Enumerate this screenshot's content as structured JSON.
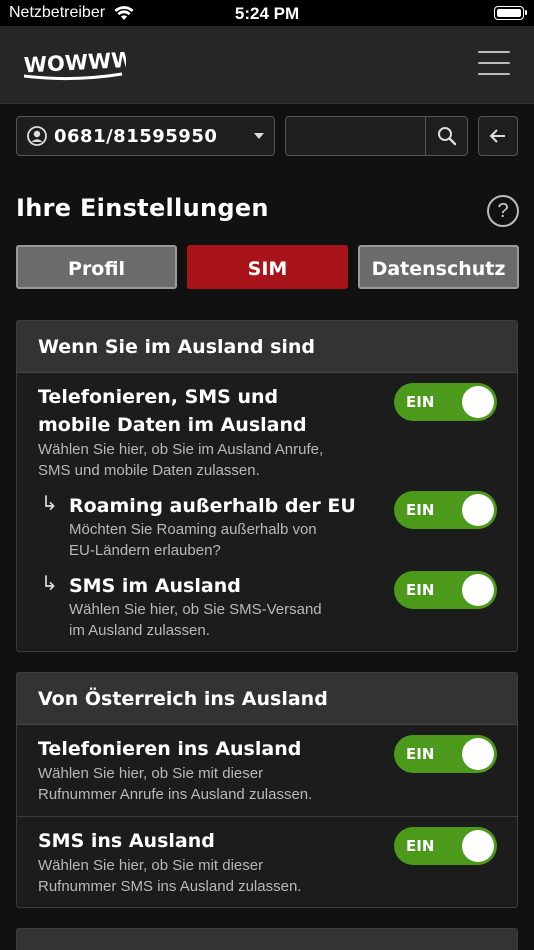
{
  "statusbar": {
    "carrier": "Netzbetreiber",
    "time": "5:24 PM"
  },
  "header": {
    "logo_text": "WOWWW!"
  },
  "number_select": {
    "value": "0681/81595950"
  },
  "search": {
    "placeholder": ""
  },
  "page": {
    "title": "Ihre Einstellungen",
    "help_label": "?"
  },
  "tabs": [
    {
      "label": "Profil",
      "active": false
    },
    {
      "label": "SIM",
      "active": true
    },
    {
      "label": "Datenschutz",
      "active": false
    }
  ],
  "colors": {
    "accent": "#a81419",
    "toggle_on": "#4c9a1c",
    "background": "#111111",
    "card_header": "#333333"
  },
  "sections": [
    {
      "title": "Wenn Sie im Ausland sind",
      "rows": [
        {
          "title_line1": "Telefonieren, SMS und",
          "title_line2": "mobile Daten im Ausland",
          "desc_line1": "Wählen Sie hier, ob Sie im Ausland Anrufe,",
          "desc_line2": "SMS und mobile Daten zulassen.",
          "toggle": "EIN"
        },
        {
          "arrow": "↳",
          "title": "Roaming außerhalb der EU",
          "desc_line1": "Möchten Sie Roaming außerhalb von",
          "desc_line2": "EU-Ländern erlauben?",
          "toggle": "EIN"
        },
        {
          "arrow": "↳",
          "title": "SMS im Ausland",
          "desc_line1": "Wählen Sie hier, ob Sie SMS-Versand",
          "desc_line2": "im Ausland zulassen.",
          "toggle": "EIN"
        }
      ]
    },
    {
      "title": "Von Österreich ins Ausland",
      "rows": [
        {
          "title": "Telefonieren ins Ausland",
          "desc_line1": "Wählen Sie hier, ob Sie mit dieser",
          "desc_line2": "Rufnummer Anrufe ins Ausland zulassen.",
          "toggle": "EIN"
        },
        {
          "title": "SMS ins Ausland",
          "desc_line1": "Wählen Sie hier, ob Sie mit dieser",
          "desc_line2": "Rufnummer SMS ins Ausland zulassen.",
          "toggle": "EIN"
        }
      ]
    }
  ]
}
